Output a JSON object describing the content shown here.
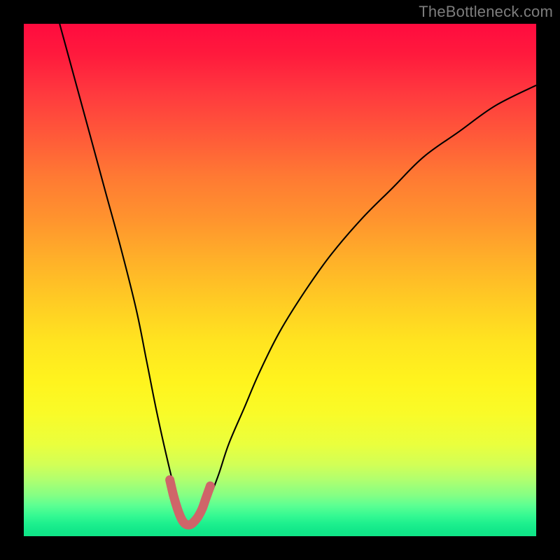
{
  "watermark": "TheBottleneck.com",
  "chart_data": {
    "type": "line",
    "title": "",
    "xlabel": "",
    "ylabel": "",
    "xlim": [
      0,
      100
    ],
    "ylim": [
      0,
      100
    ],
    "grid": false,
    "legend": false,
    "series": [
      {
        "name": "bottleneck-curve",
        "x": [
          7,
          10,
          13,
          16,
          19,
          22,
          24,
          26,
          28,
          30,
          31,
          32,
          33,
          34,
          36,
          38,
          40,
          43,
          46,
          50,
          55,
          60,
          66,
          72,
          78,
          85,
          92,
          100
        ],
        "y": [
          100,
          89,
          78,
          67,
          56,
          44,
          34,
          24,
          15,
          7,
          4,
          2,
          2,
          4,
          7,
          12,
          18,
          25,
          32,
          40,
          48,
          55,
          62,
          68,
          74,
          79,
          84,
          88
        ]
      },
      {
        "name": "optimal-zone",
        "x": [
          28.5,
          29.2,
          30.0,
          30.8,
          31.4,
          32.0,
          32.6,
          33.2,
          34.0,
          34.8,
          35.5,
          36.4
        ],
        "y": [
          11.0,
          8.0,
          5.3,
          3.3,
          2.5,
          2.2,
          2.3,
          2.8,
          3.8,
          5.3,
          7.3,
          9.8
        ]
      }
    ],
    "styles": {
      "bottleneck-curve": {
        "stroke": "#000000",
        "stroke_width": 2.1
      },
      "optimal-zone": {
        "stroke": "#cf6569",
        "stroke_width": 13,
        "linecap": "round"
      }
    },
    "background_gradient": {
      "stops": [
        {
          "pct": 0,
          "color": "#ff0b3e"
        },
        {
          "pct": 50,
          "color": "#ffcb24"
        },
        {
          "pct": 80,
          "color": "#f2ff32"
        },
        {
          "pct": 100,
          "color": "#10e487"
        }
      ]
    }
  }
}
